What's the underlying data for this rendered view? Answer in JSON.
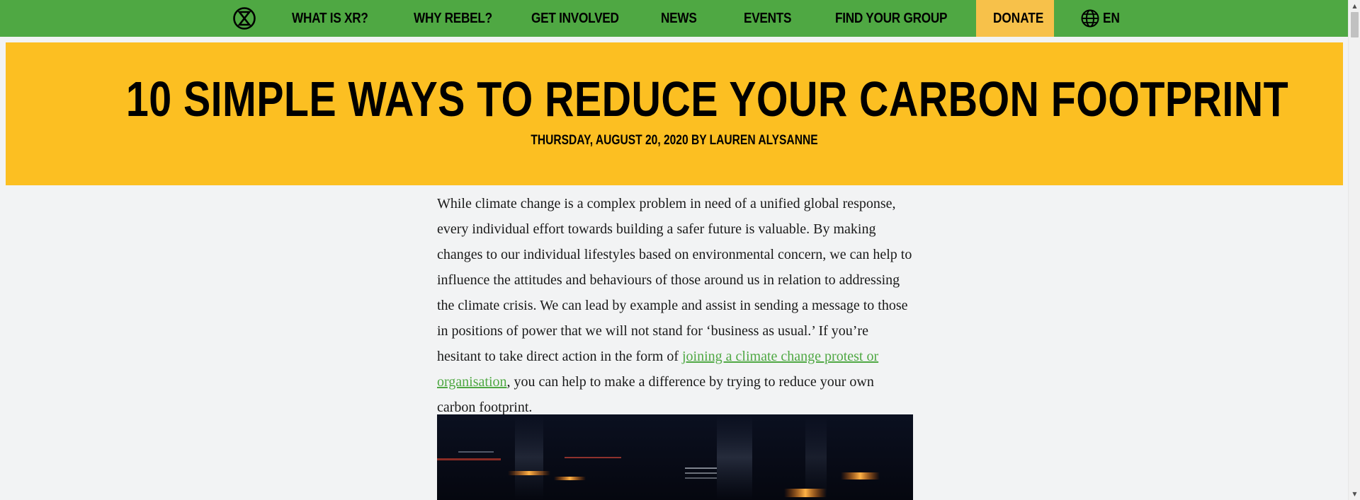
{
  "nav": {
    "items": [
      {
        "label": "WHAT IS XR?"
      },
      {
        "label": "WHY REBEL?"
      },
      {
        "label": "GET INVOLVED"
      },
      {
        "label": "NEWS"
      },
      {
        "label": "EVENTS"
      },
      {
        "label": "FIND YOUR GROUP"
      }
    ],
    "donate_label": "DONATE",
    "language_label": "EN",
    "logo_icon": "extinction-symbol-icon",
    "language_icon": "globe-icon"
  },
  "hero": {
    "title": "10 SIMPLE WAYS TO REDUCE YOUR CARBON FOOTPRINT",
    "meta": "THURSDAY, AUGUST 20, 2020 BY LAUREN ALYSANNE"
  },
  "article": {
    "intro_before_link": "While climate change is a complex problem in need of a unified global response, every individual effort towards building a safer future is valuable. By making changes to our individual lifestyles based on environmental concern, we can help to influence the attitudes and behaviours of those around us in relation to addressing the climate crisis. We can lead by example and assist in sending a message to those in positions of power that we will not stand for ‘business as usual.’ If you’re hesitant to take direct action in the form of ",
    "link_text": "joining a climate change protest or organisation",
    "intro_after_link": ", you can help to make a difference by trying to reduce your own carbon footprint."
  },
  "colors": {
    "nav_green": "#4fa843",
    "hero_yellow": "#fcbf22",
    "donate_yellow": "#f7c14a",
    "link_green": "#4fa843",
    "background": "#f2f3f4"
  }
}
